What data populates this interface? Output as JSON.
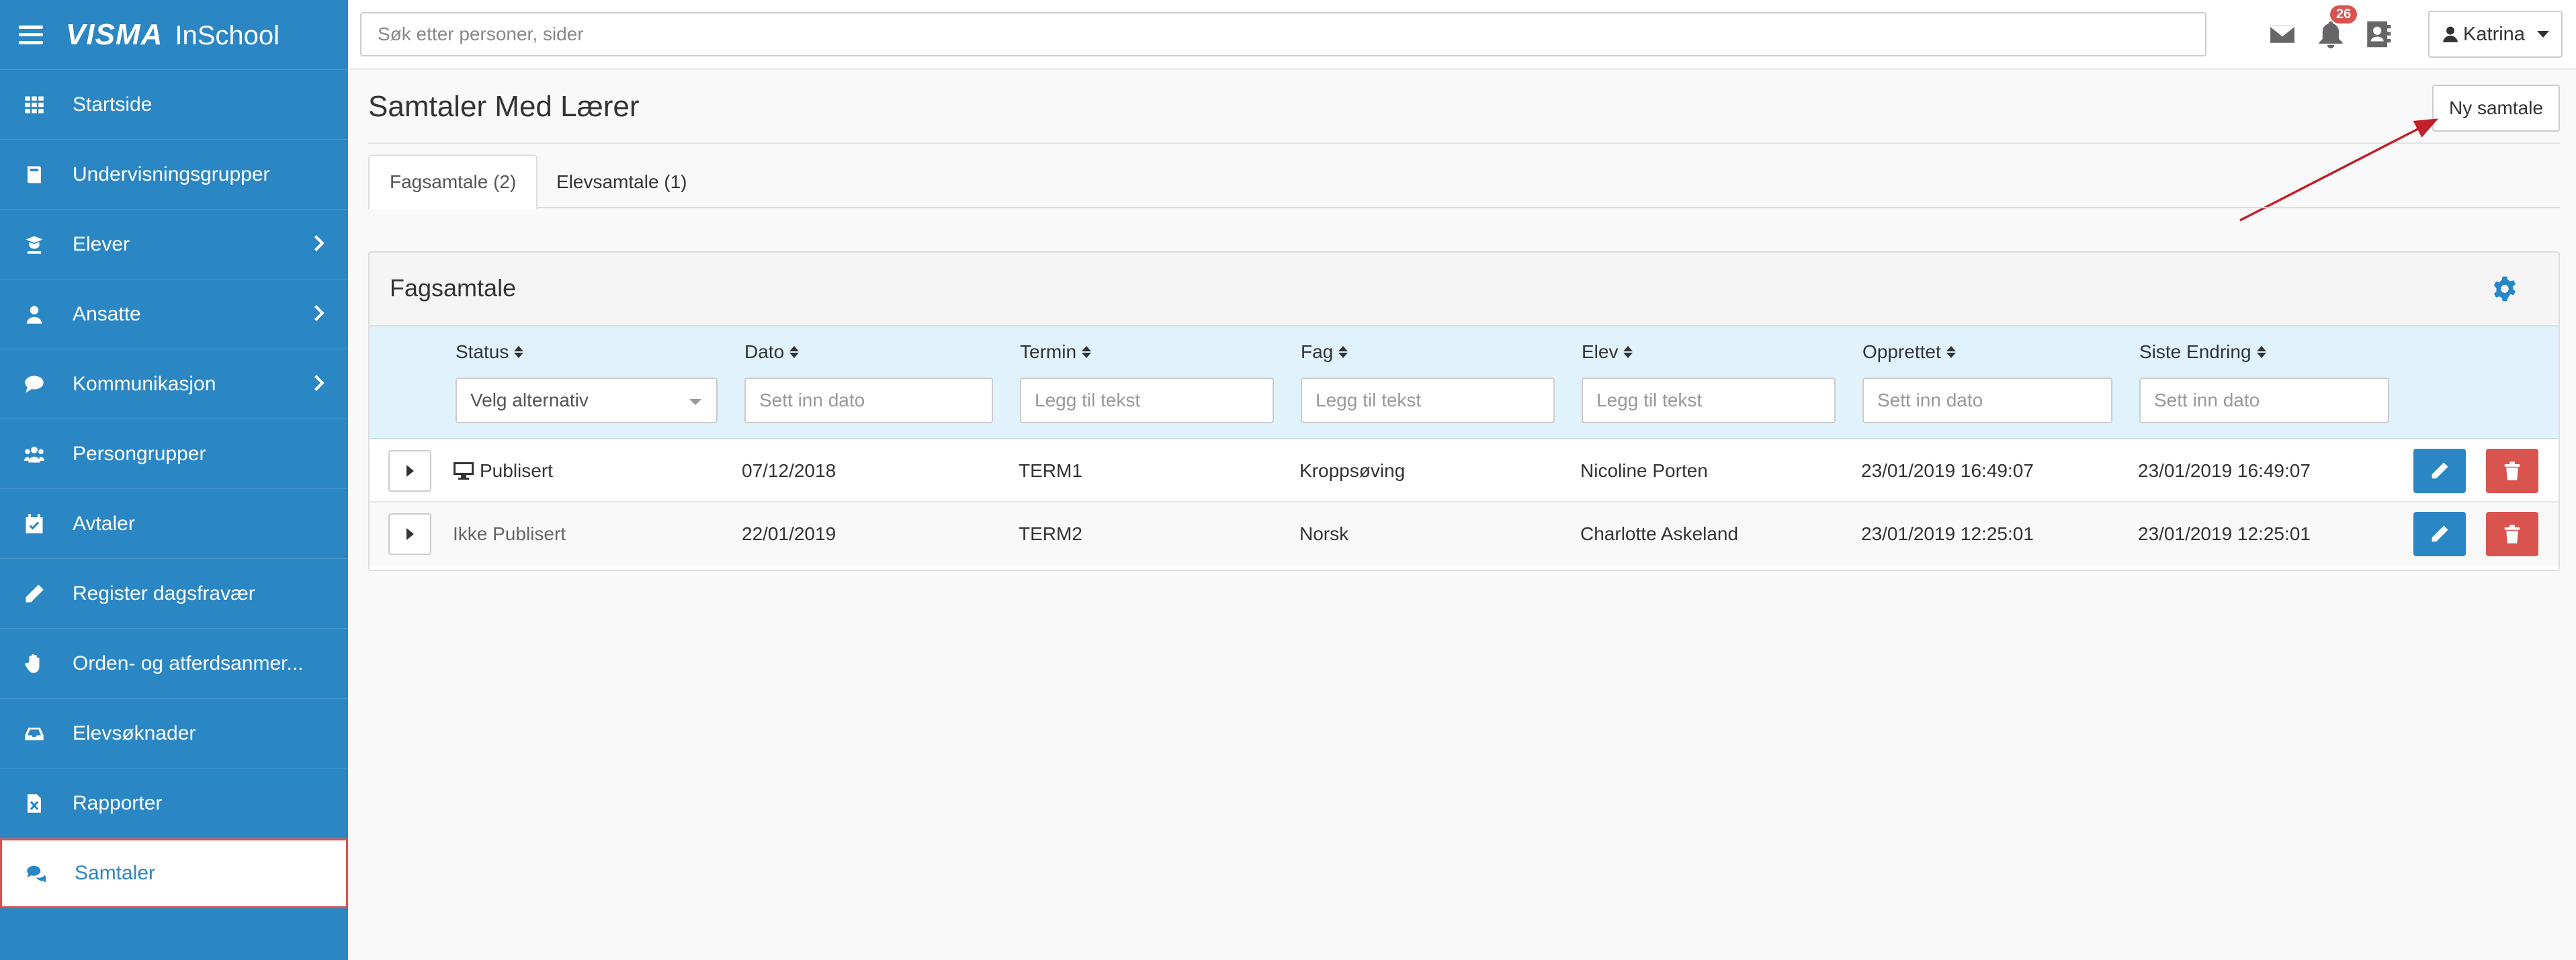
{
  "brand": {
    "logo": "VISMA",
    "product": "InSchool"
  },
  "sidebar": {
    "items": [
      {
        "label": "Startside",
        "icon": "grid-icon",
        "chevron": false
      },
      {
        "label": "Undervisningsgrupper",
        "icon": "book-icon",
        "chevron": false
      },
      {
        "label": "Elever",
        "icon": "graduate-icon",
        "chevron": true
      },
      {
        "label": "Ansatte",
        "icon": "user-icon",
        "chevron": true
      },
      {
        "label": "Kommunikasjon",
        "icon": "chat-icon",
        "chevron": true
      },
      {
        "label": "Persongrupper",
        "icon": "users-icon",
        "chevron": false
      },
      {
        "label": "Avtaler",
        "icon": "calendar-check-icon",
        "chevron": false
      },
      {
        "label": "Register dagsfravær",
        "icon": "pencil-icon",
        "chevron": false
      },
      {
        "label": "Orden- og atferdsanmer...",
        "icon": "hand-icon",
        "chevron": false
      },
      {
        "label": "Elevsøknader",
        "icon": "inbox-icon",
        "chevron": false
      },
      {
        "label": "Rapporter",
        "icon": "excel-file-icon",
        "chevron": false
      },
      {
        "label": "Samtaler",
        "icon": "comments-icon",
        "chevron": false,
        "active": true
      }
    ]
  },
  "topbar": {
    "search_placeholder": "Søk etter personer, sider",
    "notification_count": "26",
    "user_name": "Katrina"
  },
  "page": {
    "title": "Samtaler Med Lærer",
    "new_button": "Ny samtale"
  },
  "tabs": [
    {
      "label": "Fagsamtale (2)",
      "active": true
    },
    {
      "label": "Elevsamtale (1)",
      "active": false
    }
  ],
  "panel": {
    "title": "Fagsamtale",
    "columns": [
      {
        "label": "Status",
        "filter_type": "select",
        "filter_value": "Velg alternativ"
      },
      {
        "label": "Dato",
        "filter_type": "input",
        "placeholder": "Sett inn dato"
      },
      {
        "label": "Termin",
        "filter_type": "input",
        "placeholder": "Legg til tekst"
      },
      {
        "label": "Fag",
        "filter_type": "input",
        "placeholder": "Legg til tekst"
      },
      {
        "label": "Elev",
        "filter_type": "input",
        "placeholder": "Legg til tekst"
      },
      {
        "label": "Opprettet",
        "filter_type": "input",
        "placeholder": "Sett inn dato"
      },
      {
        "label": "Siste Endring",
        "filter_type": "input",
        "placeholder": "Sett inn dato"
      }
    ],
    "rows": [
      {
        "status": "Publisert",
        "dato": "07/12/2018",
        "termin": "TERM1",
        "fag": "Kroppsøving",
        "elev": "Nicoline Porten",
        "opprettet": "23/01/2019 16:49:07",
        "siste_endring": "23/01/2019 16:49:07"
      },
      {
        "status": "Ikke Publisert",
        "dato": "22/01/2019",
        "termin": "TERM2",
        "fag": "Norsk",
        "elev": "Charlotte Askeland",
        "opprettet": "23/01/2019 12:25:01",
        "siste_endring": "23/01/2019 12:25:01"
      }
    ]
  },
  "colors": {
    "primary": "#2b86c4",
    "danger": "#d9534f",
    "filter_bg": "#e0f3fc",
    "annotation": "#c0202a"
  }
}
